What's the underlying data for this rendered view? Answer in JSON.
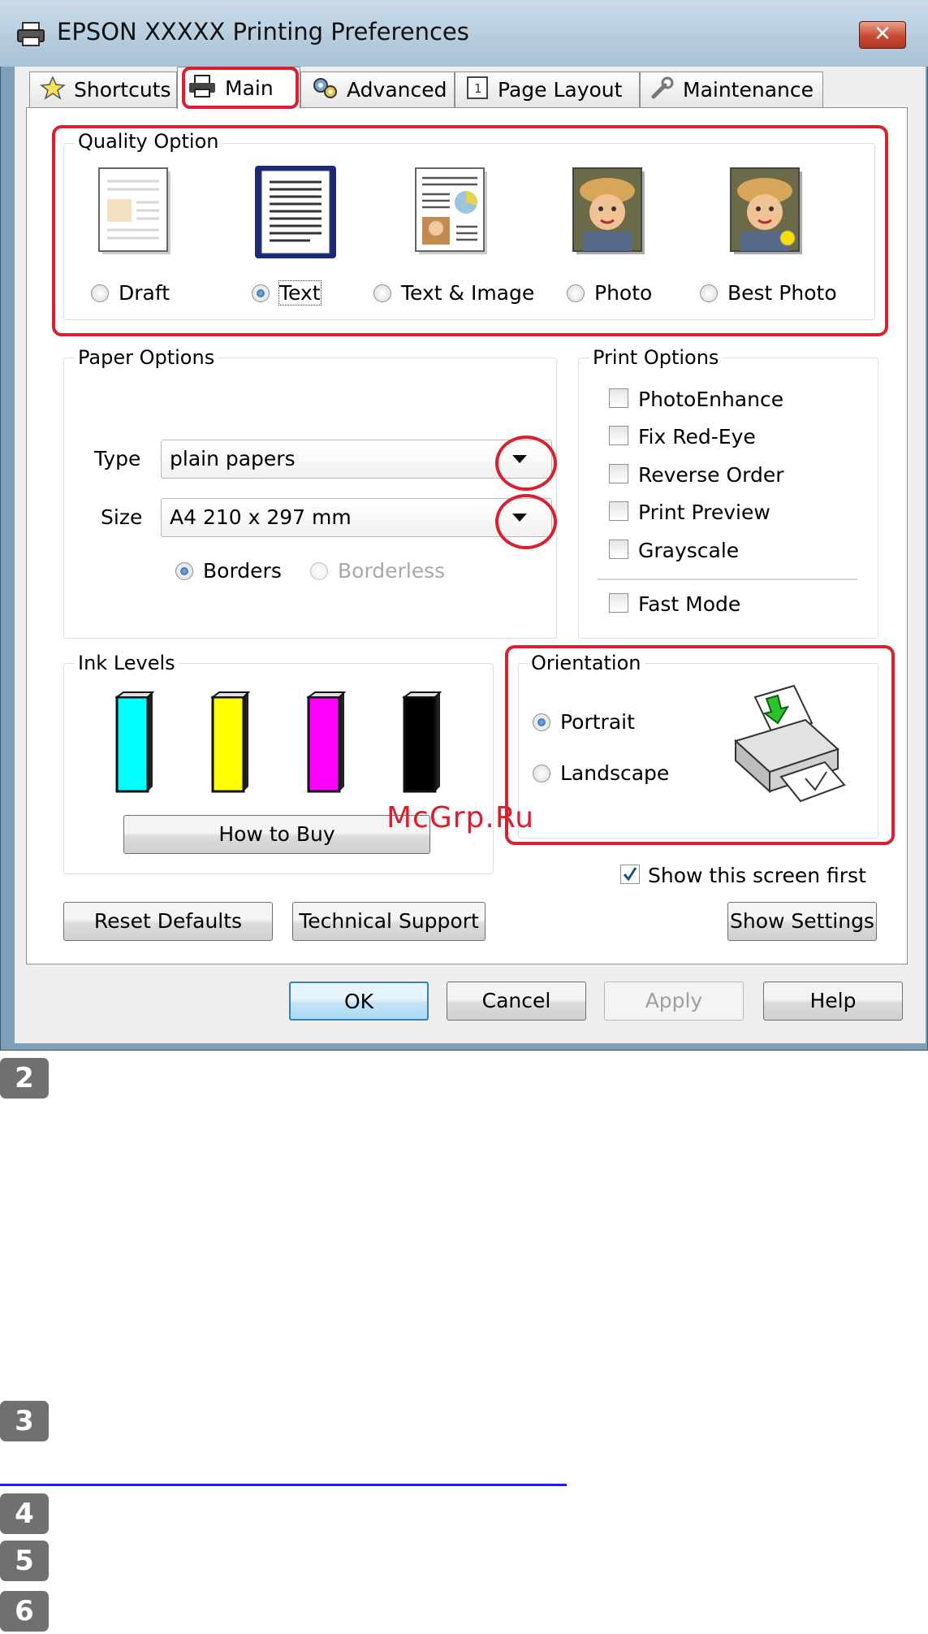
{
  "window": {
    "title": "EPSON XXXXX   Printing Preferences",
    "close_label": "✕"
  },
  "tabs": [
    {
      "label": "Shortcuts",
      "icon": "star-icon"
    },
    {
      "label": "Main",
      "icon": "printer-icon"
    },
    {
      "label": "Advanced",
      "icon": "gears-icon"
    },
    {
      "label": "Page Layout",
      "icon": "page-layout-icon"
    },
    {
      "label": "Maintenance",
      "icon": "wrench-icon"
    }
  ],
  "active_tab": "Main",
  "quality": {
    "label": "Quality Option",
    "options": [
      "Draft",
      "Text",
      "Text & Image",
      "Photo",
      "Best Photo"
    ],
    "selected": "Text"
  },
  "paper": {
    "label": "Paper Options",
    "type_label": "Type",
    "type_value": "plain papers",
    "size_label": "Size",
    "size_value": "A4 210 x 297 mm",
    "borders_label": "Borders",
    "borderless_label": "Borderless",
    "selected": "Borders"
  },
  "print_options": {
    "label": "Print Options",
    "items": [
      "PhotoEnhance",
      "Fix Red-Eye",
      "Reverse Order",
      "Print Preview",
      "Grayscale"
    ],
    "fast_mode": "Fast Mode"
  },
  "ink": {
    "label": "Ink Levels",
    "colors": [
      "#00ffff",
      "#ffff00",
      "#ff00ff",
      "#000000"
    ],
    "how_to_buy": "How to Buy"
  },
  "orientation": {
    "label": "Orientation",
    "portrait": "Portrait",
    "landscape": "Landscape",
    "selected": "Portrait"
  },
  "watermark": "McGrp.Ru",
  "show_first": {
    "label": "Show this screen first",
    "checked": true
  },
  "buttons": {
    "reset": "Reset Defaults",
    "support": "Technical Support",
    "show_settings": "Show Settings",
    "ok": "OK",
    "cancel": "Cancel",
    "apply": "Apply",
    "help": "Help"
  },
  "steps": [
    "2",
    "3",
    "4",
    "5",
    "6"
  ],
  "colors": {
    "highlight": "#d8202e",
    "link": "#1a1aff"
  }
}
